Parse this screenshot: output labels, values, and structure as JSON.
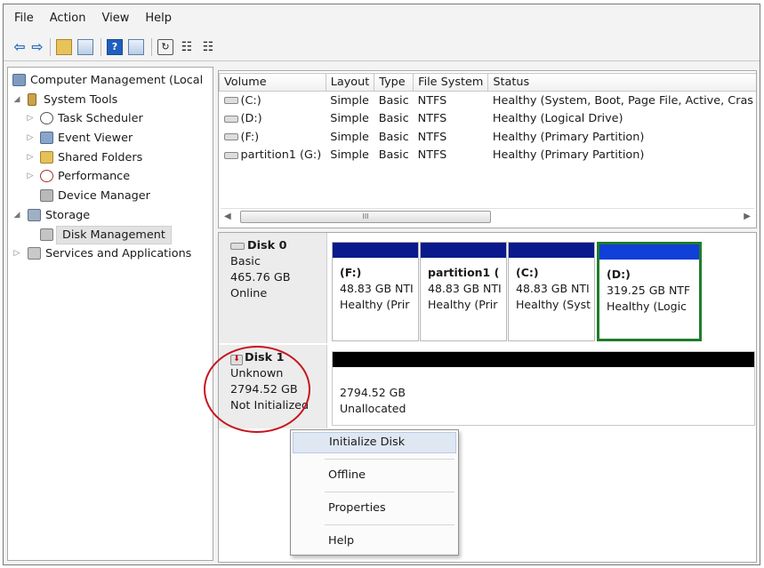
{
  "menu": [
    "File",
    "Action",
    "View",
    "Help"
  ],
  "toolbar_icons": [
    "back-arrow-icon",
    "forward-arrow-icon",
    "up-folder-icon",
    "show-hide-tree-icon",
    "help-icon",
    "properties-icon",
    "refresh-icon",
    "export-icon",
    "disk-settings-icon"
  ],
  "tree": {
    "root": "Computer Management (Local",
    "system_tools": "System Tools",
    "task_scheduler": "Task Scheduler",
    "event_viewer": "Event Viewer",
    "shared_folders": "Shared Folders",
    "performance": "Performance",
    "device_manager": "Device Manager",
    "storage": "Storage",
    "disk_management": "Disk Management",
    "services": "Services and Applications"
  },
  "volumes": {
    "headers": [
      "Volume",
      "Layout",
      "Type",
      "File System",
      "Status"
    ],
    "rows": [
      [
        "(C:)",
        "Simple",
        "Basic",
        "NTFS",
        "Healthy (System, Boot, Page File, Active, Cras"
      ],
      [
        "(D:)",
        "Simple",
        "Basic",
        "NTFS",
        "Healthy (Logical Drive)"
      ],
      [
        "(F:)",
        "Simple",
        "Basic",
        "NTFS",
        "Healthy (Primary Partition)"
      ],
      [
        "partition1 (G:)",
        "Simple",
        "Basic",
        "NTFS",
        "Healthy (Primary Partition)"
      ]
    ],
    "scroll_thumb": "III"
  },
  "disk0": {
    "name": "Disk 0",
    "type": "Basic",
    "size": "465.76 GB",
    "state": "Online",
    "partitions": [
      {
        "name": "(F:)",
        "size": "48.83 GB NTI",
        "status": "Healthy (Prir"
      },
      {
        "name": "partition1  (",
        "size": "48.83 GB NTI",
        "status": "Healthy (Prir"
      },
      {
        "name": "(C:)",
        "size": "48.83 GB NTI",
        "status": "Healthy (Syst"
      },
      {
        "name": "(D:)",
        "size": "319.25 GB NTF",
        "status": "Healthy (Logic"
      }
    ]
  },
  "disk1": {
    "name": "Disk 1",
    "type": "Unknown",
    "size": "2794.52 GB",
    "state": "Not Initialized",
    "unalloc_size": "2794.52 GB",
    "unalloc_label": "Unallocated"
  },
  "context_menu": [
    "Initialize Disk",
    "Offline",
    "Properties",
    "Help"
  ],
  "colors": {
    "partition_bar": "#0a1a8c",
    "selected_partition_border": "#1e7d2a",
    "unallocated_bar": "#000000",
    "annotation": "#c8141e",
    "menu_highlight": "#dfe7f2"
  }
}
